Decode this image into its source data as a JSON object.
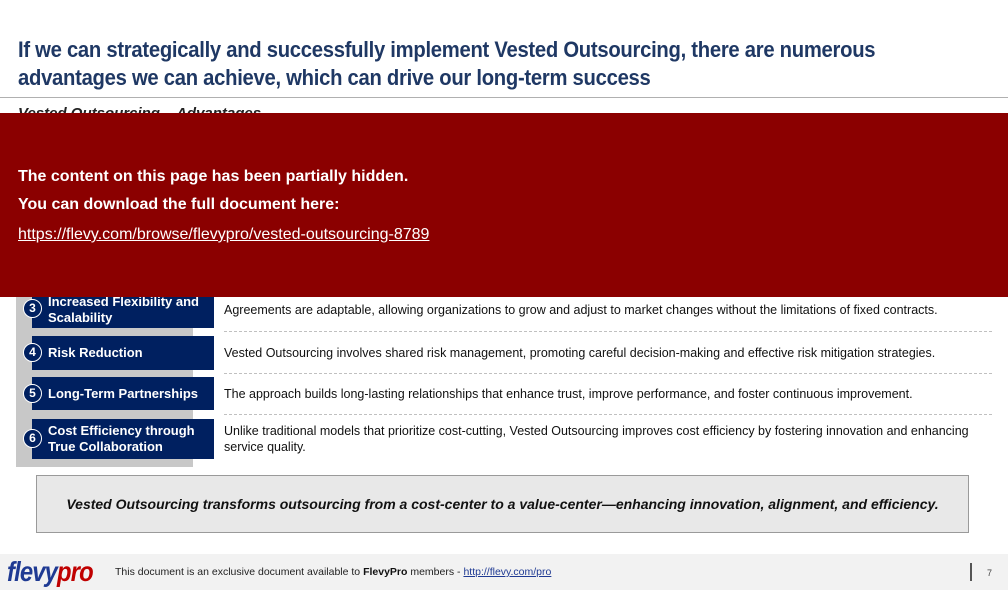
{
  "header": {
    "title": "If we can strategically and successfully implement Vested Outsourcing, there are numerous advantages we can achieve, which can drive our long-term success",
    "subtitle": "Vested Outsourcing – Advantages"
  },
  "overlay": {
    "line1": "The content on this page has been partially hidden.",
    "line2": "You can download the full document here:",
    "link": "https://flevy.com/browse/flevypro/vested-outsourcing-8789",
    "color": "#8B0000"
  },
  "advantages": [
    {
      "number": "3",
      "label": "Increased Flexibility and Scalability",
      "description": "Agreements are adaptable, allowing organizations to grow and adjust to market changes without the limitations of fixed contracts."
    },
    {
      "number": "4",
      "label": "Risk Reduction",
      "description": "Vested Outsourcing involves shared risk management, promoting careful decision-making and effective risk mitigation strategies."
    },
    {
      "number": "5",
      "label": "Long-Term Partnerships",
      "description": "The approach builds long-lasting relationships that enhance trust, improve performance, and foster continuous improvement."
    },
    {
      "number": "6",
      "label": "Cost Efficiency through True Collaboration",
      "description": "Unlike traditional models that prioritize cost-cutting, Vested Outsourcing improves cost efficiency by fostering innovation and enhancing service quality."
    }
  ],
  "summary": "Vested Outsourcing transforms outsourcing from a cost-center to a value-center—enhancing innovation, alignment, and efficiency.",
  "footer": {
    "logo_part1": "flevy",
    "logo_part2": "pro",
    "text_before": "This document is an exclusive document available to ",
    "brand": "FlevyPro",
    "text_after": " members - ",
    "link": "http://flevy.com/pro",
    "page_number": "7"
  },
  "colors": {
    "title": "#1F3864",
    "navy": "#002060",
    "sidebar": "#C8C8C8"
  }
}
